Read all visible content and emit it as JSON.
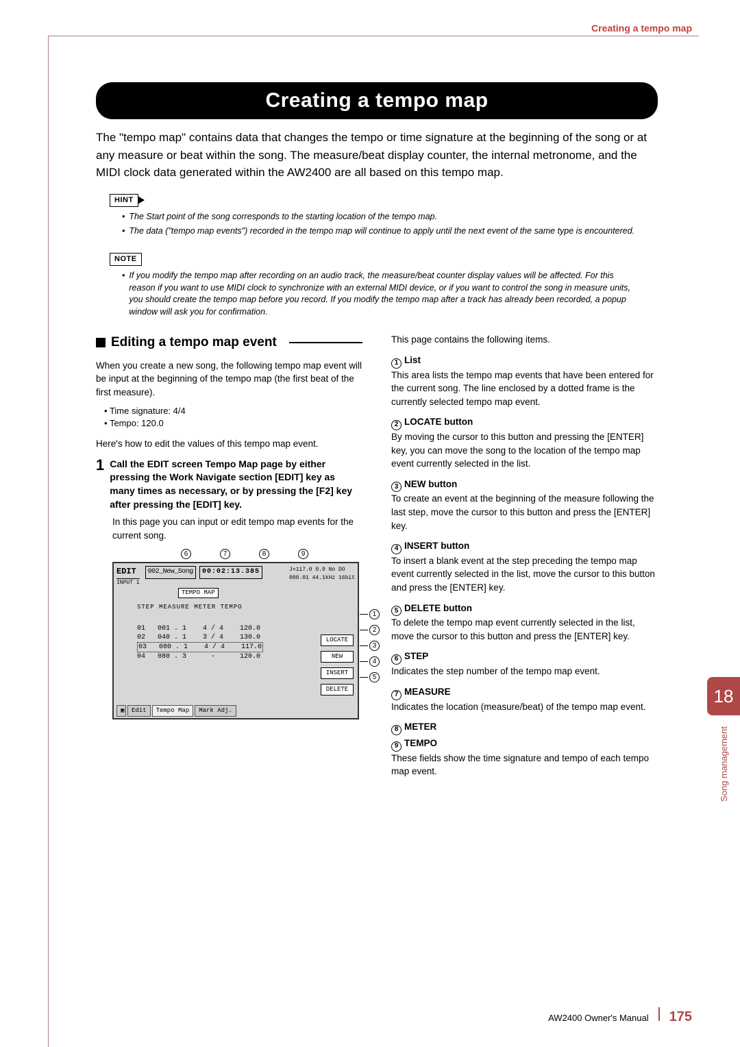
{
  "header": {
    "running": "Creating a tempo map"
  },
  "title": "Creating a tempo map",
  "intro": "The \"tempo map\" contains data that changes the tempo or time signature at the beginning of the song or at any measure or beat within the song. The measure/beat display counter, the internal metronome, and the MIDI clock data generated within the AW2400 are all based on this tempo map.",
  "hint": {
    "label": "HINT",
    "items": [
      "The Start point of the song corresponds to the starting location of the tempo map.",
      "The data (\"tempo map events\") recorded in the tempo map will continue to apply until the next event of the same type is encountered."
    ]
  },
  "note": {
    "label": "NOTE",
    "text": "If you modify the tempo map after recording on an audio track, the measure/beat counter display values will be affected. For this reason if you want to use MIDI clock to synchronize with an external MIDI device, or if you want to control the song in measure units, you should create the tempo map before you record. If you modify the tempo map after a track has already been recorded, a popup window will ask you for confirmation."
  },
  "left": {
    "heading": "Editing a tempo map event",
    "p1": "When you create a new song, the following tempo map event will be input at the beginning of the tempo map (the first beat of the first measure).",
    "defaults": [
      "Time signature: 4/4",
      "Tempo: 120.0"
    ],
    "p2": "Here's how to edit the values of this tempo map event.",
    "step1": {
      "num": "1",
      "text": "Call the EDIT screen Tempo Map page by either pressing the Work Navigate section [EDIT] key as many times as necessary, or by pressing the [F2] key after pressing the [EDIT] key.",
      "sub": "In this page you can input or edit tempo map events for the current song."
    },
    "screen": {
      "song": "002_New_Song",
      "edit_label": "EDIT",
      "input_label": "INPUT 1",
      "counter": "00:02:13.385",
      "hdr_right": "J=117.0   0.0    No DO",
      "subhdr_right": "080.01 44.1kHz 16bit",
      "tab": "TEMPO MAP",
      "col_hdr": "STEP  MEASURE    METER    TEMPO",
      "rows": [
        "01   001 . 1    4 / 4    120.0",
        "02   040 . 1    3 / 4    130.0",
        "03   080 . 1    4 / 4    117.0",
        "04   080 . 3      -      120.0"
      ],
      "buttons": [
        "LOCATE",
        "NEW",
        "INSERT",
        "DELETE"
      ],
      "bottom_tabs": [
        "Edit",
        "Tempo Map",
        "Mark Adj."
      ]
    },
    "top_callouts": [
      "6",
      "7",
      "8",
      "9"
    ],
    "side_callouts": [
      "1",
      "2",
      "3",
      "4",
      "5"
    ]
  },
  "right": {
    "lead": "This page contains the following items.",
    "items": [
      {
        "n": "1",
        "t": "List",
        "b": "This area lists the tempo map events that have been entered for the current song. The line enclosed by a dotted frame is the currently selected tempo map event."
      },
      {
        "n": "2",
        "t": "LOCATE button",
        "b": "By moving the cursor to this button and pressing the [ENTER] key, you can move the song to the location of the tempo map event currently selected in the list."
      },
      {
        "n": "3",
        "t": "NEW button",
        "b": "To create an event at the beginning of the measure following the last step, move the cursor to this button and press the [ENTER] key."
      },
      {
        "n": "4",
        "t": "INSERT button",
        "b": "To insert a blank event at the step preceding the tempo map event currently selected in the list, move the cursor to this button and press the [ENTER] key."
      },
      {
        "n": "5",
        "t": "DELETE button",
        "b": "To delete the tempo map event currently selected in the list, move the cursor to this button and press the [ENTER] key."
      },
      {
        "n": "6",
        "t": "STEP",
        "b": "Indicates the step number of the tempo map event."
      },
      {
        "n": "7",
        "t": "MEASURE",
        "b": "Indicates the location (measure/beat) of the tempo map event."
      },
      {
        "n": "8",
        "t": "METER",
        "b": ""
      },
      {
        "n": "9",
        "t": "TEMPO",
        "b": "These fields show the time signature and tempo of each tempo map event."
      }
    ]
  },
  "chapter": {
    "num": "18",
    "label": "Song management"
  },
  "footer": {
    "manual": "AW2400  Owner's Manual",
    "page": "175"
  }
}
